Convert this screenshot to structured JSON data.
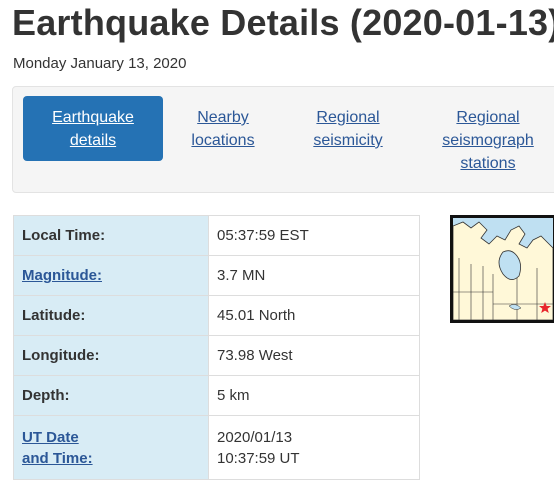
{
  "header": {
    "title": "Earthquake Details (2020-01-13)",
    "date": "Monday January 13, 2020"
  },
  "tabs": [
    {
      "label_line1": "Earthquake",
      "label_line2": "details",
      "label_line3": "",
      "active": true
    },
    {
      "label_line1": "Nearby",
      "label_line2": "locations",
      "label_line3": "",
      "active": false
    },
    {
      "label_line1": "Regional",
      "label_line2": "seismicity",
      "label_line3": "",
      "active": false
    },
    {
      "label_line1": "Regional",
      "label_line2": "seismograph",
      "label_line3": "stations",
      "active": false
    }
  ],
  "details": {
    "local_time": {
      "label": "Local Time:",
      "value": "05:37:59 EST"
    },
    "magnitude": {
      "label": "Magnitude:",
      "value": "3.7 MN"
    },
    "latitude": {
      "label": "Latitude:",
      "value": "45.01 North"
    },
    "longitude": {
      "label": "Longitude:",
      "value": "73.98 West"
    },
    "depth": {
      "label": "Depth:",
      "value": "5 km"
    },
    "ut": {
      "label_line1": "UT Date",
      "label_line2": "and Time:",
      "value_line1": "2020/01/13",
      "value_line2": "10:37:59 UT"
    }
  },
  "map": {
    "icon": "canada-map-icon",
    "marker_icon": "epicentre-star-icon",
    "land_color": "#fff8d8",
    "water_color": "#bfe0f2",
    "marker_color": "#e8262c"
  },
  "colors": {
    "accent": "#2572b4",
    "link": "#2b5797",
    "label_bg": "#d8ecf5"
  }
}
